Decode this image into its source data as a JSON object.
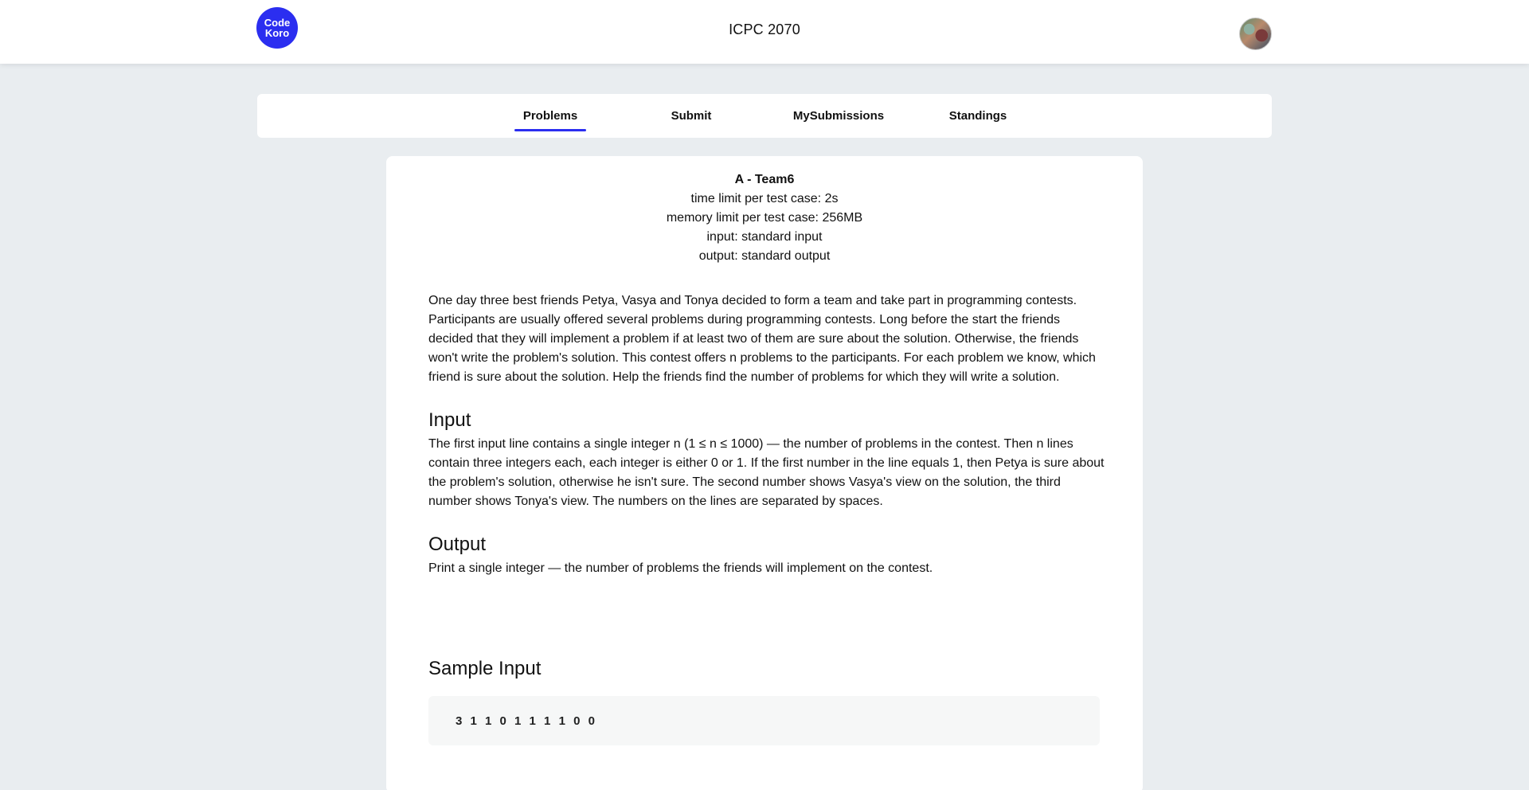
{
  "header": {
    "logo_line1": "Code",
    "logo_line2": "Koro",
    "title": "ICPC 2070"
  },
  "tabs": [
    {
      "label": "Problems",
      "active": true
    },
    {
      "label": "Submit",
      "active": false
    },
    {
      "label": "MySubmissions",
      "active": false
    },
    {
      "label": "Standings",
      "active": false
    }
  ],
  "problem": {
    "title": "A - Team6",
    "time_limit": "time limit per test case: 2s",
    "memory_limit": "memory limit per test case: 256MB",
    "input": "input: standard input",
    "output": "output: standard output",
    "statement": "One day three best friends Petya, Vasya and Tonya decided to form a team and take part in programming contests. Participants are usually offered several problems during programming contests. Long before the start the friends decided that they will implement a problem if at least two of them are sure about the solution. Otherwise, the friends won't write the problem's solution. This contest offers n problems to the participants. For each problem we know, which friend is sure about the solution. Help the friends find the number of problems for which they will write a solution.",
    "input_heading": "Input",
    "input_text": "The first input line contains a single integer n (1 ≤ n ≤ 1000) — the number of problems in the contest. Then n lines contain three integers each, each integer is either 0 or 1. If the first number in the line equals 1, then Petya is sure about the problem's solution, otherwise he isn't sure. The second number shows Vasya's view on the solution, the third number shows Tonya's view. The numbers on the lines are separated by spaces.",
    "output_heading": "Output",
    "output_text": "Print a single integer — the number of problems the friends will implement on the contest.",
    "sample_input_heading": "Sample Input",
    "sample_input": "3 1 1 0 1 1 1 1 0 0"
  },
  "colors": {
    "accent": "#2b2ef0",
    "background": "#e9edf0"
  }
}
